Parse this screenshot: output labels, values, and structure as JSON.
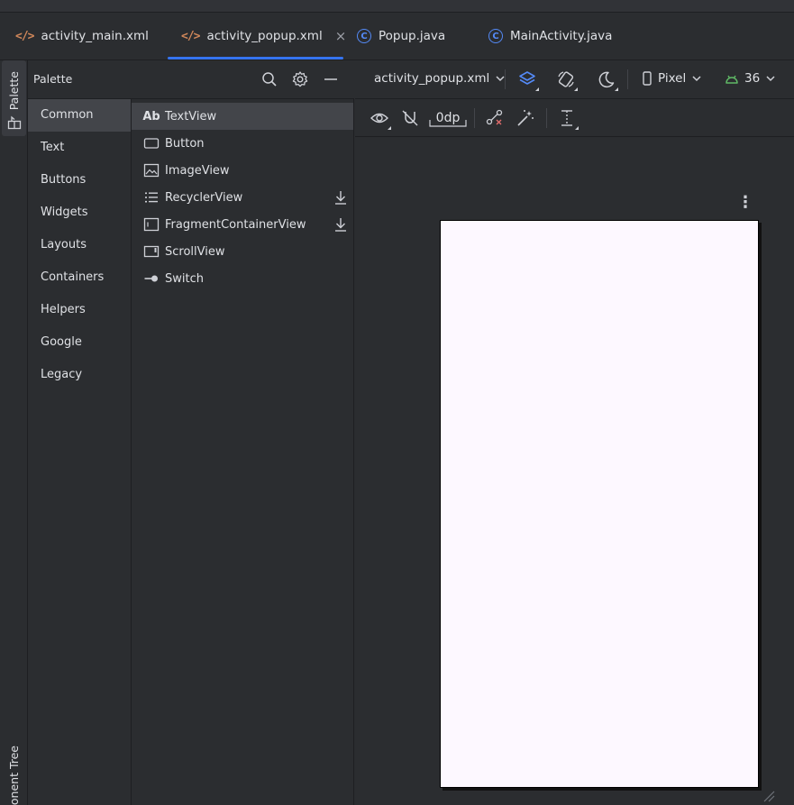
{
  "tabs": [
    {
      "label": "activity_main.xml",
      "icon": "xml-file-icon",
      "active": false
    },
    {
      "label": "activity_popup.xml",
      "icon": "xml-file-icon",
      "active": true,
      "close": "×"
    },
    {
      "label": "Popup.java",
      "icon": "java-class-icon",
      "active": false
    },
    {
      "label": "MainActivity.java",
      "icon": "java-class-icon",
      "active": false
    }
  ],
  "tool_strip": {
    "palette_label": "Palette",
    "component_tree_label": "onent Tree"
  },
  "palette": {
    "title": "Palette",
    "categories": [
      "Common",
      "Text",
      "Buttons",
      "Widgets",
      "Layouts",
      "Containers",
      "Helpers",
      "Google",
      "Legacy"
    ],
    "selected_category": "Common",
    "widgets": [
      {
        "label": "TextView",
        "icon": "textview-icon",
        "glyph": "Ab"
      },
      {
        "label": "Button",
        "icon": "button-icon"
      },
      {
        "label": "ImageView",
        "icon": "imageview-icon"
      },
      {
        "label": "RecyclerView",
        "icon": "recyclerview-icon",
        "download": true
      },
      {
        "label": "FragmentContainerView",
        "icon": "fragment-container-icon",
        "download": true
      },
      {
        "label": "ScrollView",
        "icon": "scrollview-icon"
      },
      {
        "label": "Switch",
        "icon": "switch-icon"
      }
    ]
  },
  "design_toolbar": {
    "file_selector": "activity_popup.xml",
    "device": "Pixel",
    "api_level": "36",
    "margin_value": "0dp"
  },
  "canvas": {
    "more_glyph": "⋮"
  },
  "colors": {
    "accent": "#3574f0",
    "background": "#2b2d30",
    "selected_row": "#43454a",
    "xml_icon": "#d0875a",
    "class_icon": "#548af7",
    "android_icon": "#5fb865",
    "device_screen": "#fdf8ff"
  }
}
